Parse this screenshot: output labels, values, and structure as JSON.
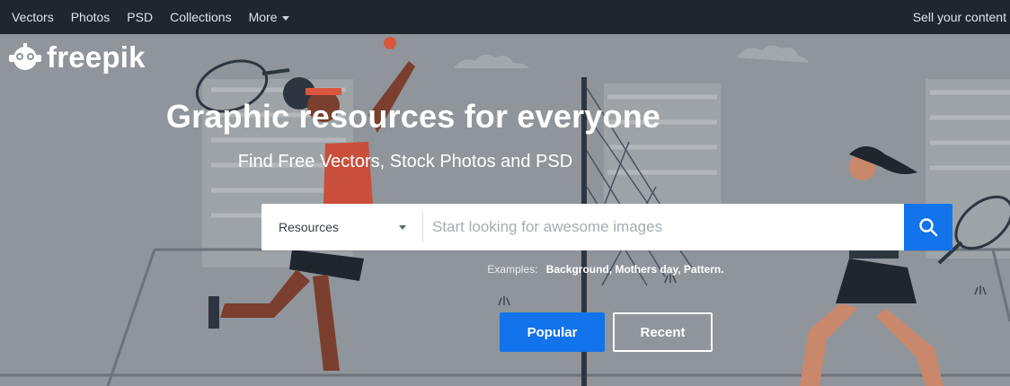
{
  "topnav": {
    "items": [
      "Vectors",
      "Photos",
      "PSD",
      "Collections"
    ],
    "more_label": "More",
    "sell_label": "Sell your content"
  },
  "logo": {
    "text": "freepik"
  },
  "hero": {
    "headline": "Graphic resources for everyone",
    "subheadline": "Find Free Vectors, Stock Photos and PSD"
  },
  "search": {
    "category": "Resources",
    "placeholder": "Start looking for awesome images"
  },
  "examples": {
    "prefix": "Examples:",
    "list": "Background, Mothers day, Pattern."
  },
  "buttons": {
    "popular": "Popular",
    "recent": "Recent"
  },
  "colors": {
    "nav_bg": "#1f262d",
    "hero_bg": "#8f959b",
    "accent": "#1273eb"
  }
}
